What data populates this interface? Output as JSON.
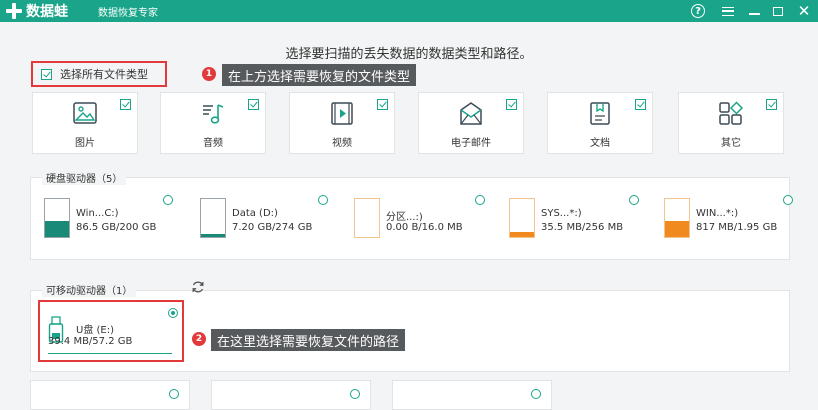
{
  "app": {
    "name": "数据蛙",
    "subtitle": "数据恢复专家",
    "help_symbol": "?",
    "close_symbol": "✕"
  },
  "instruction": "选择要扫描的丢失数据的数据类型和路径。",
  "select_all": {
    "label": "选择所有文件类型",
    "checked": true
  },
  "callouts": [
    {
      "number": "1",
      "text": "在上方选择需要恢复的文件类型"
    },
    {
      "number": "2",
      "text": "在这里选择需要恢复文件的路径"
    }
  ],
  "file_types": [
    {
      "label": "图片",
      "icon": "image-icon",
      "checked": true
    },
    {
      "label": "音频",
      "icon": "music-icon",
      "checked": true
    },
    {
      "label": "视频",
      "icon": "video-icon",
      "checked": true
    },
    {
      "label": "电子邮件",
      "icon": "email-icon",
      "checked": true
    },
    {
      "label": "文档",
      "icon": "document-icon",
      "checked": true
    },
    {
      "label": "其它",
      "icon": "other-icon",
      "checked": true
    }
  ],
  "hard_drives": {
    "title": "硬盘驱动器（5）",
    "drives": [
      {
        "name": "Win...C:)",
        "size": "86.5 GB/200 GB",
        "fill": 0.43,
        "color": "#1a8a78",
        "selected": false
      },
      {
        "name": "Data (D:)",
        "size": "7.20 GB/274 GB",
        "fill": 0.03,
        "color": "#1a8a78",
        "selected": false
      },
      {
        "name": "分区...:)",
        "size": "0.00  B/16.0 MB",
        "fill": 0.0,
        "color": "#f08a1e",
        "selected": false
      },
      {
        "name": "SYS...*:)",
        "size": "35.5 MB/256 MB",
        "fill": 0.14,
        "color": "#f08a1e",
        "selected": false
      },
      {
        "name": "WIN...*:)",
        "size": "817 MB/1.95 GB",
        "fill": 0.42,
        "color": "#f08a1e",
        "selected": false
      }
    ]
  },
  "removable": {
    "title": "可移动驱动器（1）",
    "drives": [
      {
        "name": "U盘 (E:)",
        "size": "39.4 MB/57.2 GB",
        "selected": true
      }
    ]
  },
  "colors": {
    "accent": "#1aa58a",
    "alert": "#e2393b"
  }
}
